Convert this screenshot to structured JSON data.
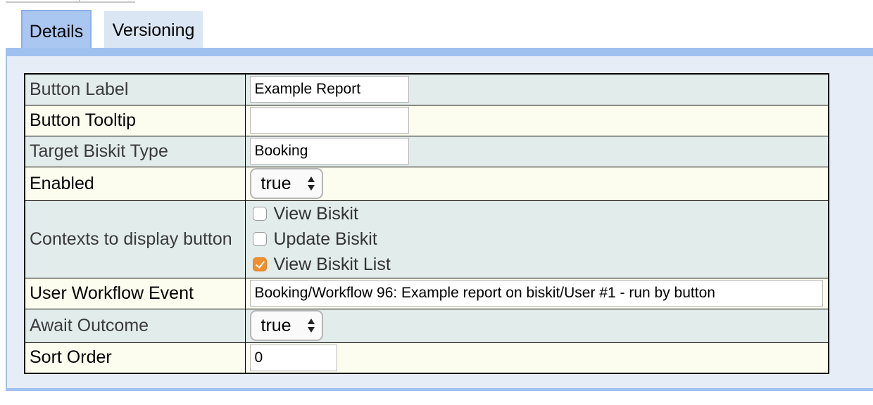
{
  "tabs": [
    {
      "label": "Details",
      "active": true
    },
    {
      "label": "Versioning",
      "active": false
    }
  ],
  "form": {
    "button_label": {
      "label": "Button Label",
      "value": "Example Report"
    },
    "button_tooltip": {
      "label": "Button Tooltip",
      "value": ""
    },
    "target_biskit_type": {
      "label": "Target Biskit Type",
      "value": "Booking"
    },
    "enabled": {
      "label": "Enabled",
      "value": "true"
    },
    "contexts": {
      "label": "Contexts to display button",
      "options": [
        {
          "label": "View Biskit",
          "checked": false
        },
        {
          "label": "Update Biskit",
          "checked": false
        },
        {
          "label": "View Biskit List",
          "checked": true
        }
      ]
    },
    "user_workflow_event": {
      "label": "User Workflow Event",
      "value": "Booking/Workflow 96: Example report on biskit/User #1 - run by button"
    },
    "await_outcome": {
      "label": "Await Outcome",
      "value": "true"
    },
    "sort_order": {
      "label": "Sort Order",
      "value": "0"
    }
  },
  "colors": {
    "tab_active": "#a9c7f0",
    "tab_inactive": "#dbe6f4",
    "panel_border": "#9fc1f0",
    "row_teal": "#e2ecea",
    "row_cream": "#fdfdef",
    "checkbox_checked": "#ee8f32"
  }
}
